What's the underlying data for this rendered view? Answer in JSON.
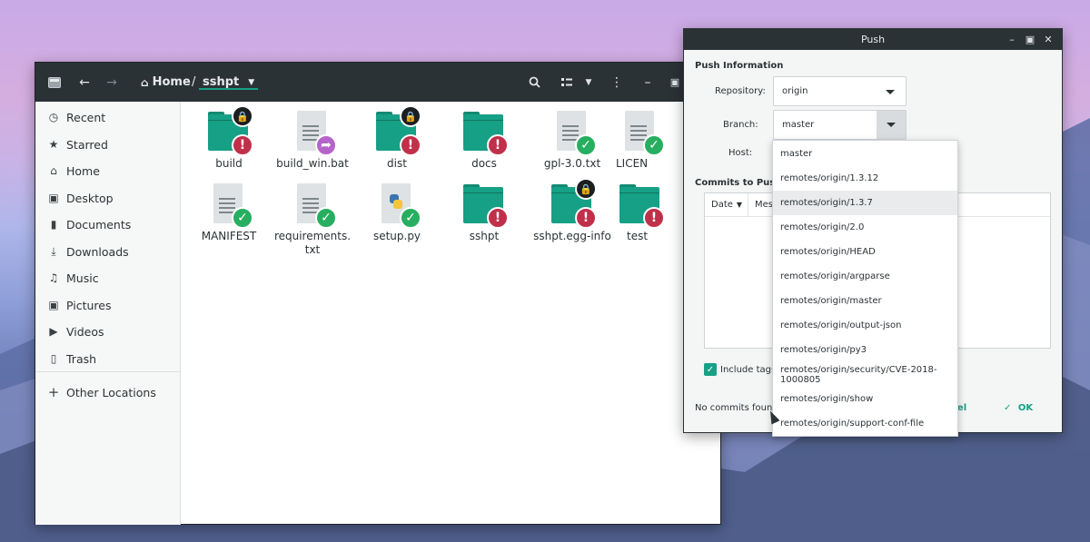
{
  "file_manager": {
    "path": {
      "home": "Home",
      "separator": "/",
      "current": "sshpt"
    },
    "sidebar": [
      {
        "label": "Recent",
        "icon": "clock-icon"
      },
      {
        "label": "Starred",
        "icon": "star-icon"
      },
      {
        "label": "Home",
        "icon": "home-icon"
      },
      {
        "label": "Desktop",
        "icon": "desktop-icon"
      },
      {
        "label": "Documents",
        "icon": "document-icon"
      },
      {
        "label": "Downloads",
        "icon": "download-icon"
      },
      {
        "label": "Music",
        "icon": "music-icon"
      },
      {
        "label": "Pictures",
        "icon": "pictures-icon"
      },
      {
        "label": "Videos",
        "icon": "video-icon"
      },
      {
        "label": "Trash",
        "icon": "trash-icon"
      },
      {
        "label": "Other Locations",
        "icon": "plus-icon"
      }
    ],
    "files": [
      {
        "name": "build",
        "type": "folder",
        "emblems": [
          "lock",
          "error"
        ]
      },
      {
        "name": "build_win.bat",
        "type": "document",
        "emblems": [
          "share"
        ]
      },
      {
        "name": "dist",
        "type": "folder",
        "emblems": [
          "lock",
          "error"
        ]
      },
      {
        "name": "docs",
        "type": "folder",
        "emblems": [
          "error"
        ]
      },
      {
        "name": "gpl-3.0.txt",
        "type": "document",
        "emblems": [
          "ok"
        ]
      },
      {
        "name": "LICEN",
        "type": "document",
        "emblems": [
          "ok"
        ]
      },
      {
        "name": "MANIFEST",
        "type": "document",
        "emblems": [
          "ok"
        ]
      },
      {
        "name": "requirements.\ntxt",
        "type": "document",
        "emblems": [
          "ok"
        ]
      },
      {
        "name": "setup.py",
        "type": "python",
        "emblems": [
          "ok"
        ]
      },
      {
        "name": "sshpt",
        "type": "folder",
        "emblems": [
          "error"
        ]
      },
      {
        "name": "sshpt.egg-info",
        "type": "folder",
        "emblems": [
          "lock",
          "error"
        ]
      },
      {
        "name": "test",
        "type": "folder",
        "emblems": [
          "error"
        ]
      }
    ]
  },
  "push_dialog": {
    "title": "Push",
    "section_push_info": "Push Information",
    "repository_label": "Repository:",
    "repository_value": "origin",
    "branch_label": "Branch:",
    "branch_value": "master",
    "host_label": "Host:",
    "section_commits": "Commits to Push",
    "col_date": "Date",
    "col_message": "Mess",
    "include_tags_label": "Include tags",
    "status": "No commits found",
    "cancel_label": "cel",
    "ok_label": "OK",
    "branch_options": [
      "master",
      "remotes/origin/1.3.12",
      "remotes/origin/1.3.7",
      "remotes/origin/2.0",
      "remotes/origin/HEAD",
      "remotes/origin/argparse",
      "remotes/origin/master",
      "remotes/origin/output-json",
      "remotes/origin/py3",
      "remotes/origin/security/CVE-2018-1000805",
      "remotes/origin/show",
      "remotes/origin/support-conf-file"
    ],
    "highlighted_option_index": 2
  },
  "colors": {
    "accent": "#16a085",
    "error": "#c0304a",
    "ok": "#27ae60",
    "header": "#2b3236"
  }
}
